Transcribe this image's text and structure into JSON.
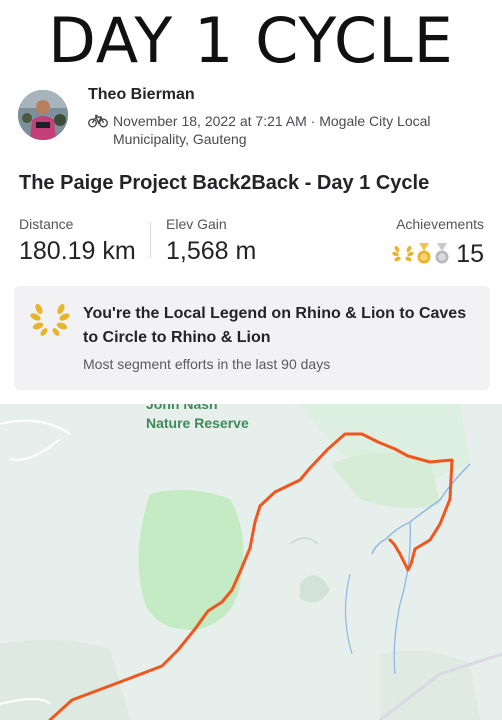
{
  "banner": {
    "title": "DAY 1 CYCLE"
  },
  "athlete": {
    "name": "Theo Bierman",
    "activity_icon": "bicycle-icon",
    "date_location": "November 18, 2022 at 7:21 AM · Mogale City Local Municipality, Gauteng"
  },
  "activity": {
    "title": "The Paige Project Back2Back - Day 1 Cycle",
    "stats": [
      {
        "label": "Distance",
        "value": "180.19 km"
      },
      {
        "label": "Elev Gain",
        "value": "1,568 m"
      }
    ],
    "achievements": {
      "label": "Achievements",
      "icons": [
        "laurel-icon",
        "gold-medal-icon",
        "silver-medal-icon"
      ],
      "count": "15"
    }
  },
  "local_legend": {
    "icon": "laurel-icon",
    "title": "You're the Local Legend on Rhino & Lion to Caves to Circle to Rhino & Lion",
    "subtitle": "Most segment efforts in the last 90 days"
  },
  "map": {
    "labels": [
      "John Nash",
      "Nature Reserve"
    ],
    "route_color": "#f0561d"
  },
  "colors": {
    "accent": "#f0561d",
    "legend_gold": "#e7b52b",
    "map_green": "#c4ebc4"
  }
}
